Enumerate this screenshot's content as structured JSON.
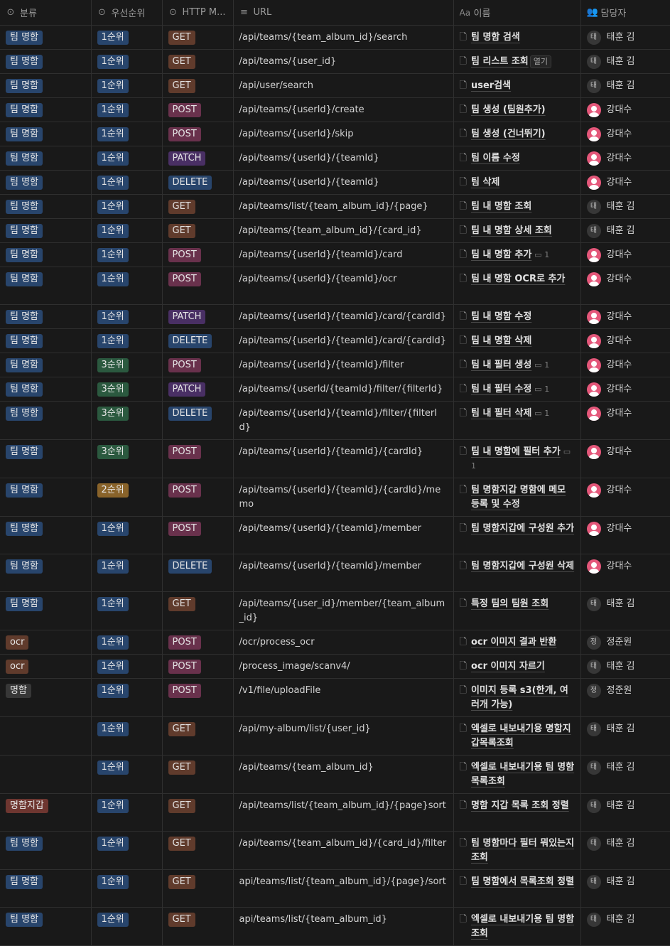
{
  "columns": [
    {
      "icon": "select-icon",
      "label": "분류"
    },
    {
      "icon": "select-icon",
      "label": "우선순위"
    },
    {
      "icon": "select-icon",
      "label": "HTTP M..."
    },
    {
      "icon": "text-icon",
      "label": "URL"
    },
    {
      "icon": "title-icon",
      "label": "이름"
    },
    {
      "icon": "person-icon",
      "label": "담당자"
    }
  ],
  "colors": {
    "cat": {
      "팀 명함": "#28456c",
      "ocr": "#603b2c",
      "명함": "#373737",
      "명함지갑": "#6e3630"
    },
    "pri": {
      "1순위": "#28456c",
      "3순위": "#2b593f",
      "2순위": "#89632a"
    },
    "method": {
      "GET": "#603b2c",
      "POST": "#69314c",
      "PATCH": "#492f64",
      "DELETE": "#28456c"
    }
  },
  "rows": [
    {
      "cat": "팀 명함",
      "pri": "1순위",
      "method": "GET",
      "url": "/api/teams/{team_album_id}/search",
      "name": "팀 명함 검색",
      "owner": "태훈 김",
      "av": "letter",
      "av_letter": "태",
      "h": 33
    },
    {
      "cat": "팀 명함",
      "pri": "1순위",
      "method": "GET",
      "url": "/api/teams/{user_id}",
      "name": "팀 리스트 조회",
      "open": "열기",
      "owner": "태훈 김",
      "av": "letter",
      "av_letter": "태",
      "h": 33
    },
    {
      "cat": "팀 명함",
      "pri": "1순위",
      "method": "GET",
      "url": "/api/user/search",
      "name": "user검색",
      "owner": "태훈 김",
      "av": "letter",
      "av_letter": "태",
      "h": 33
    },
    {
      "cat": "팀 명함",
      "pri": "1순위",
      "method": "POST",
      "url": "/api/teams/{userId}/create",
      "name": "팀  생성 (팀원추가)",
      "owner": "강대수",
      "av": "pink",
      "h": 33
    },
    {
      "cat": "팀 명함",
      "pri": "1순위",
      "method": "POST",
      "url": "/api/teams/{userId}/skip",
      "name": "팀  생성 (건너뛰기)",
      "owner": "강대수",
      "av": "pink",
      "h": 33
    },
    {
      "cat": "팀 명함",
      "pri": "1순위",
      "method": "PATCH",
      "url": "/api/teams/{userId}/{teamId}",
      "name": "팀 이름 수정",
      "owner": "강대수",
      "av": "pink",
      "h": 33
    },
    {
      "cat": "팀 명함",
      "pri": "1순위",
      "method": "DELETE",
      "url": "/api/teams/{userId}/{teamId}",
      "name": "팀 삭제",
      "owner": "강대수",
      "av": "pink",
      "h": 33
    },
    {
      "cat": "팀 명함",
      "pri": "1순위",
      "method": "GET",
      "url": "/api/teams/list/{team_album_id}/{page}",
      "name": "팀 내 명함 조회",
      "owner": "태훈 김",
      "av": "letter",
      "av_letter": "태",
      "h": 33
    },
    {
      "cat": "팀 명함",
      "pri": "1순위",
      "method": "GET",
      "url": "/api/teams/{team_album_id}/{card_id}",
      "name": "팀 내 명함 상세 조회",
      "owner": "태훈 김",
      "av": "letter",
      "av_letter": "태",
      "h": 33
    },
    {
      "cat": "팀 명함",
      "pri": "1순위",
      "method": "POST",
      "url": "/api/teams/{userId}/{teamId}/card",
      "name": "팀 내 명함 추가",
      "comment": "1",
      "owner": "강대수",
      "av": "pink",
      "h": 33
    },
    {
      "cat": "팀 명함",
      "pri": "1순위",
      "method": "POST",
      "url": "/api/teams/{userId}/{teamId}/ocr",
      "name": "팀 내 명함 OCR로 추가",
      "owner": "강대수",
      "av": "pink",
      "h": 53
    },
    {
      "cat": "팀 명함",
      "pri": "1순위",
      "method": "PATCH",
      "url": "/api/teams/{userId}/{teamId}/card/{cardId}",
      "name": "팀 내 명함 수정",
      "owner": "강대수",
      "av": "pink",
      "h": 33
    },
    {
      "cat": "팀 명함",
      "pri": "1순위",
      "method": "DELETE",
      "url": "/api/teams/{userId}/{teamId}/card/{cardId}",
      "name": "팀 내 명함 삭제",
      "owner": "강대수",
      "av": "pink",
      "h": 33
    },
    {
      "cat": "팀 명함",
      "pri": "3순위",
      "method": "POST",
      "url": "/api/teams/{userId}/{teamId}/filter",
      "name": "팀 내 필터 생성",
      "comment": "1",
      "owner": "강대수",
      "av": "pink",
      "h": 33
    },
    {
      "cat": "팀 명함",
      "pri": "3순위",
      "method": "PATCH",
      "url": "/api/teams/{userId/{teamId}/filter/{filterId}",
      "name": "팀 내 필터 수정",
      "comment": "1",
      "owner": "강대수",
      "av": "pink",
      "h": 33
    },
    {
      "cat": "팀 명함",
      "pri": "3순위",
      "method": "DELETE",
      "url": "/api/teams/{userId}/{teamId}/filter/{filterId}",
      "name": "팀 내 필터 삭제",
      "comment": "1",
      "owner": "강대수",
      "av": "pink",
      "h": 33
    },
    {
      "cat": "팀 명함",
      "pri": "3순위",
      "method": "POST",
      "url": "/api/teams/{userId}/{teamId}/{cardId}",
      "name": "팀 내 명함에 필터 추가",
      "comment": "1",
      "owner": "강대수",
      "av": "pink",
      "h": 53
    },
    {
      "cat": "팀 명함",
      "pri": "2순위",
      "method": "POST",
      "url": "/api/teams/{userId}/{teamId}/{cardId}/memo",
      "name": "팀 명함지갑 명함에 메모 등록 및 수정",
      "owner": "강대수",
      "av": "pink",
      "h": 53
    },
    {
      "cat": "팀 명함",
      "pri": "1순위",
      "method": "POST",
      "url": "/api/teams/{userId}/{teamId}/member",
      "name": "팀 명함지갑에 구성원 추가",
      "owner": "강대수",
      "av": "pink",
      "h": 53
    },
    {
      "cat": "팀 명함",
      "pri": "1순위",
      "method": "DELETE",
      "url": "/api/teams/{userId}/{teamId}/member",
      "name": "팀 명함지갑에 구성원 삭제",
      "owner": "강대수",
      "av": "pink",
      "h": 53
    },
    {
      "cat": "팀 명함",
      "pri": "1순위",
      "method": "GET",
      "url": "/api/teams/{user_id}/member/{team_album_id}",
      "name": "특정 팀의 팀원 조회",
      "owner": "태훈 김",
      "av": "letter",
      "av_letter": "태",
      "h": 33
    },
    {
      "cat": "ocr",
      "pri": "1순위",
      "method": "POST",
      "url": "/ocr/process_ocr",
      "name": "ocr 이미지 결과 반환",
      "owner": "정준원",
      "av": "letter",
      "av_letter": "정",
      "h": 33
    },
    {
      "cat": "ocr",
      "pri": "1순위",
      "method": "POST",
      "url": "/process_image/scanv4/",
      "name": "ocr 이미지 자르기",
      "owner": "태훈 김",
      "av": "letter",
      "av_letter": "태",
      "h": 33
    },
    {
      "cat": "명함",
      "pri": "1순위",
      "method": "POST",
      "url": "/v1/file/uploadFile",
      "name": "이미지 등록 s3(한개, 여러개 가능)",
      "owner": "정준원",
      "av": "letter",
      "av_letter": "정",
      "h": 53
    },
    {
      "cat": "",
      "pri": "1순위",
      "method": "GET",
      "url": "/api/my-album/list/{user_id}",
      "name": "엑셀로 내보내기용 명함지갑목록조회",
      "owner": "태훈 김",
      "av": "letter",
      "av_letter": "태",
      "h": 53
    },
    {
      "cat": "",
      "pri": "1순위",
      "method": "GET",
      "url": "/api/teams/{team_album_id}",
      "name": "엑셀로 내보내기용 팀 명함 목록조회",
      "owner": "태훈 김",
      "av": "letter",
      "av_letter": "태",
      "h": 53
    },
    {
      "cat": "명함지갑",
      "pri": "1순위",
      "method": "GET",
      "url": "/api/teams/list/{team_album_id}/{page}sort",
      "name": "명함 지갑 목록 조회 정렬",
      "owner": "태훈 김",
      "av": "letter",
      "av_letter": "태",
      "h": 53
    },
    {
      "cat": "팀 명함",
      "pri": "1순위",
      "method": "GET",
      "url": "/api/teams/{team_album_id}/{card_id}/filter",
      "name": "팀 명함마다 필터 뭐있는지 조회",
      "owner": "태훈 김",
      "av": "letter",
      "av_letter": "태",
      "h": 53
    },
    {
      "cat": "팀 명함",
      "pri": "1순위",
      "method": "GET",
      "url": "api/teams/list/{team_album_id}/{page}/sort",
      "name": "팀 명함에서 목록조회 정렬",
      "owner": "태훈 김",
      "av": "letter",
      "av_letter": "태",
      "h": 53
    },
    {
      "cat": "팀 명함",
      "pri": "1순위",
      "method": "GET",
      "url": "api/teams/list/{team_album_id}",
      "name": "엑셀로 내보내기용 팀 명함 조회",
      "owner": "태훈 김",
      "av": "letter",
      "av_letter": "태",
      "h": 53
    }
  ]
}
